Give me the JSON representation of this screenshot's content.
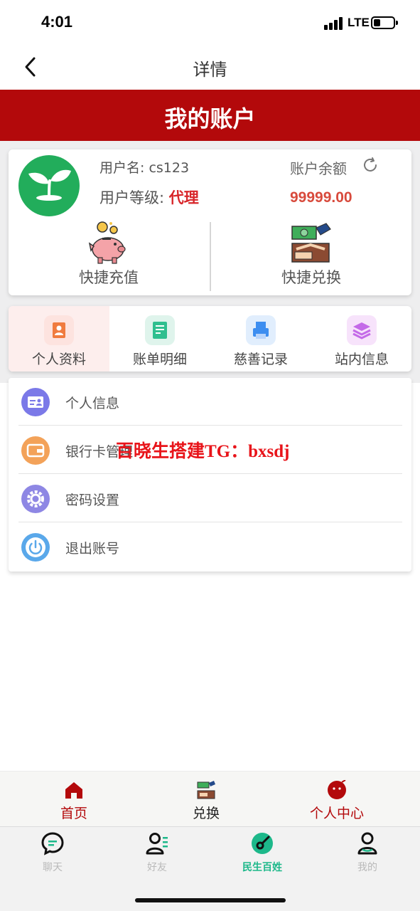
{
  "status_bar": {
    "time": "4:01",
    "network": "LTE",
    "battery_level": 0.3
  },
  "nav": {
    "title": "详情",
    "back_icon": "chevron-left-icon"
  },
  "header": {
    "title": "我的账户"
  },
  "account": {
    "username_label": "用户名: cs123",
    "level_prefix": "用户等级:",
    "level_value": "代理",
    "balance_label": "账户余额",
    "balance_value": "99999.00",
    "refresh_icon": "refresh-icon",
    "quick_recharge_label": "快捷充值",
    "quick_exchange_label": "快捷兑换"
  },
  "tabs": [
    {
      "label": "个人资料",
      "icon": "profile-card-icon",
      "color": "#f07b3f",
      "active": true
    },
    {
      "label": "账单明细",
      "icon": "bill-icon",
      "color": "#2fbf8f"
    },
    {
      "label": "慈善记录",
      "icon": "printer-icon",
      "color": "#3d8ef0"
    },
    {
      "label": "站内信息",
      "icon": "layers-icon",
      "color": "#c46ae8"
    }
  ],
  "list": [
    {
      "label": "个人信息",
      "icon": "id-card-icon",
      "color": "#7b79e8"
    },
    {
      "label": "银行卡管理",
      "icon": "wallet-icon",
      "color": "#f3a259"
    },
    {
      "label": "密码设置",
      "icon": "gear-icon",
      "color": "#8e87e4"
    },
    {
      "label": "退出账号",
      "icon": "power-icon",
      "color": "#5aa8ea"
    }
  ],
  "watermark": "百晓生搭建TG：bxsdj",
  "app_nav": [
    {
      "label": "首页",
      "icon": "home-icon",
      "color": "#b3090b"
    },
    {
      "label": "兑换",
      "icon": "exchange-icon",
      "color": "#222222"
    },
    {
      "label": "个人中心",
      "icon": "user-face-icon",
      "color": "#b3090b"
    }
  ],
  "system_nav": [
    {
      "label": "聊天",
      "icon": "chat-icon"
    },
    {
      "label": "好友",
      "icon": "friends-icon"
    },
    {
      "label": "民生百姓",
      "icon": "compass-icon",
      "active": true
    },
    {
      "label": "我的",
      "icon": "me-icon"
    }
  ],
  "colors": {
    "brand_red": "#b3090b",
    "avatar_green": "#22ad5b",
    "balance_red": "#d84a3c",
    "active_green": "#1db88a"
  }
}
